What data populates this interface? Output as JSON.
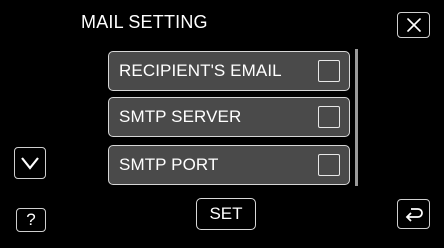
{
  "header": {
    "title": "MAIL SETTING",
    "close_icon": "close-x-icon"
  },
  "menu": {
    "items": [
      {
        "label": "RECIPIENT'S EMAIL",
        "checked": false
      },
      {
        "label": "SMTP SERVER",
        "checked": false
      },
      {
        "label": "SMTP PORT",
        "checked": false
      }
    ]
  },
  "nav": {
    "down_icon": "chevron-down-icon",
    "help_label": "?",
    "back_icon": "return-arrow-icon"
  },
  "footer": {
    "set_label": "SET"
  },
  "colors": {
    "background": "#000000",
    "item_fill": "#4a4a4a",
    "border": "#d6d6d6",
    "text": "#ffffff"
  }
}
